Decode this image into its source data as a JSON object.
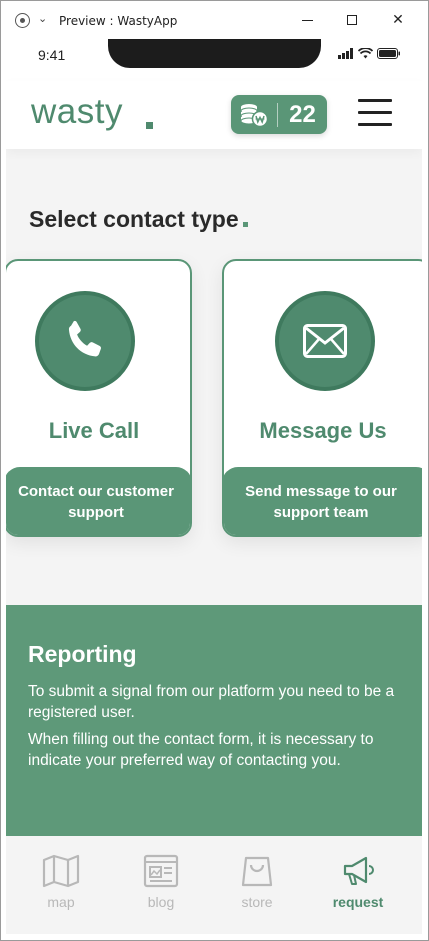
{
  "window": {
    "title": "Preview : WastyApp",
    "minimize": "minimize",
    "maximize": "maximize",
    "close": "✕"
  },
  "statusbar": {
    "time": "9:41"
  },
  "header": {
    "logo": "wasty",
    "coins": "22"
  },
  "main": {
    "title": "Select contact type",
    "cards": [
      {
        "name": "Live Call",
        "description": "Contact our customer support",
        "icon": "phone-icon"
      },
      {
        "name": "Message Us",
        "description": "Send message to our support team",
        "icon": "envelope-icon"
      }
    ]
  },
  "reporting": {
    "title": "Reporting",
    "paragraphs": [
      "To submit a signal from our platform you need to be a registered user.",
      "When filling out the contact form, it is necessary to indicate your preferred way of contacting you."
    ]
  },
  "tabbar": {
    "items": [
      {
        "label": "map",
        "icon": "map-icon",
        "active": false
      },
      {
        "label": "blog",
        "icon": "blog-icon",
        "active": false
      },
      {
        "label": "store",
        "icon": "shopping-bag-icon",
        "active": false
      },
      {
        "label": "request",
        "icon": "megaphone-icon",
        "active": true
      }
    ]
  },
  "colors": {
    "brand": "#5a9677",
    "text": "#2a2a2a",
    "inactive": "#b8b8b8"
  }
}
